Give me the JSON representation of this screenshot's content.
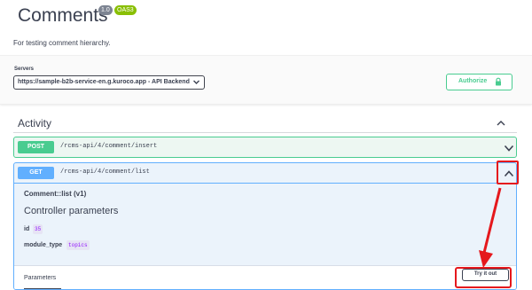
{
  "header": {
    "title": "Comments",
    "version_badge": "1.0",
    "spec_badge": "OAS3",
    "description": "For testing comment hierarchy."
  },
  "servers": {
    "label": "Servers",
    "selected": "https://sample-b2b-service-en.g.kuroco.app - API Backend",
    "chevron_icon": "chevron-down-icon"
  },
  "authorize": {
    "label": "Authorize",
    "icon": "lock-icon"
  },
  "section": {
    "title": "Activity",
    "chevron_icon": "chevron-up-icon"
  },
  "operations": [
    {
      "method": "POST",
      "path": "/rcms-api/4/comment/insert",
      "expanded": false,
      "chevron_icon": "chevron-down-icon"
    },
    {
      "method": "GET",
      "path": "/rcms-api/4/comment/list",
      "expanded": true,
      "chevron_icon": "chevron-up-icon",
      "name": "Comment::list (v1)",
      "subtitle": "Controller parameters",
      "params": [
        {
          "name": "id",
          "value": "35"
        },
        {
          "name": "module_type",
          "value": "topics"
        }
      ],
      "tab_label": "Parameters",
      "try_label": "Try it out"
    }
  ],
  "colors": {
    "post": "#49cc90",
    "get": "#61affe",
    "annotation_red": "#e5181d",
    "text": "#3b4151"
  }
}
